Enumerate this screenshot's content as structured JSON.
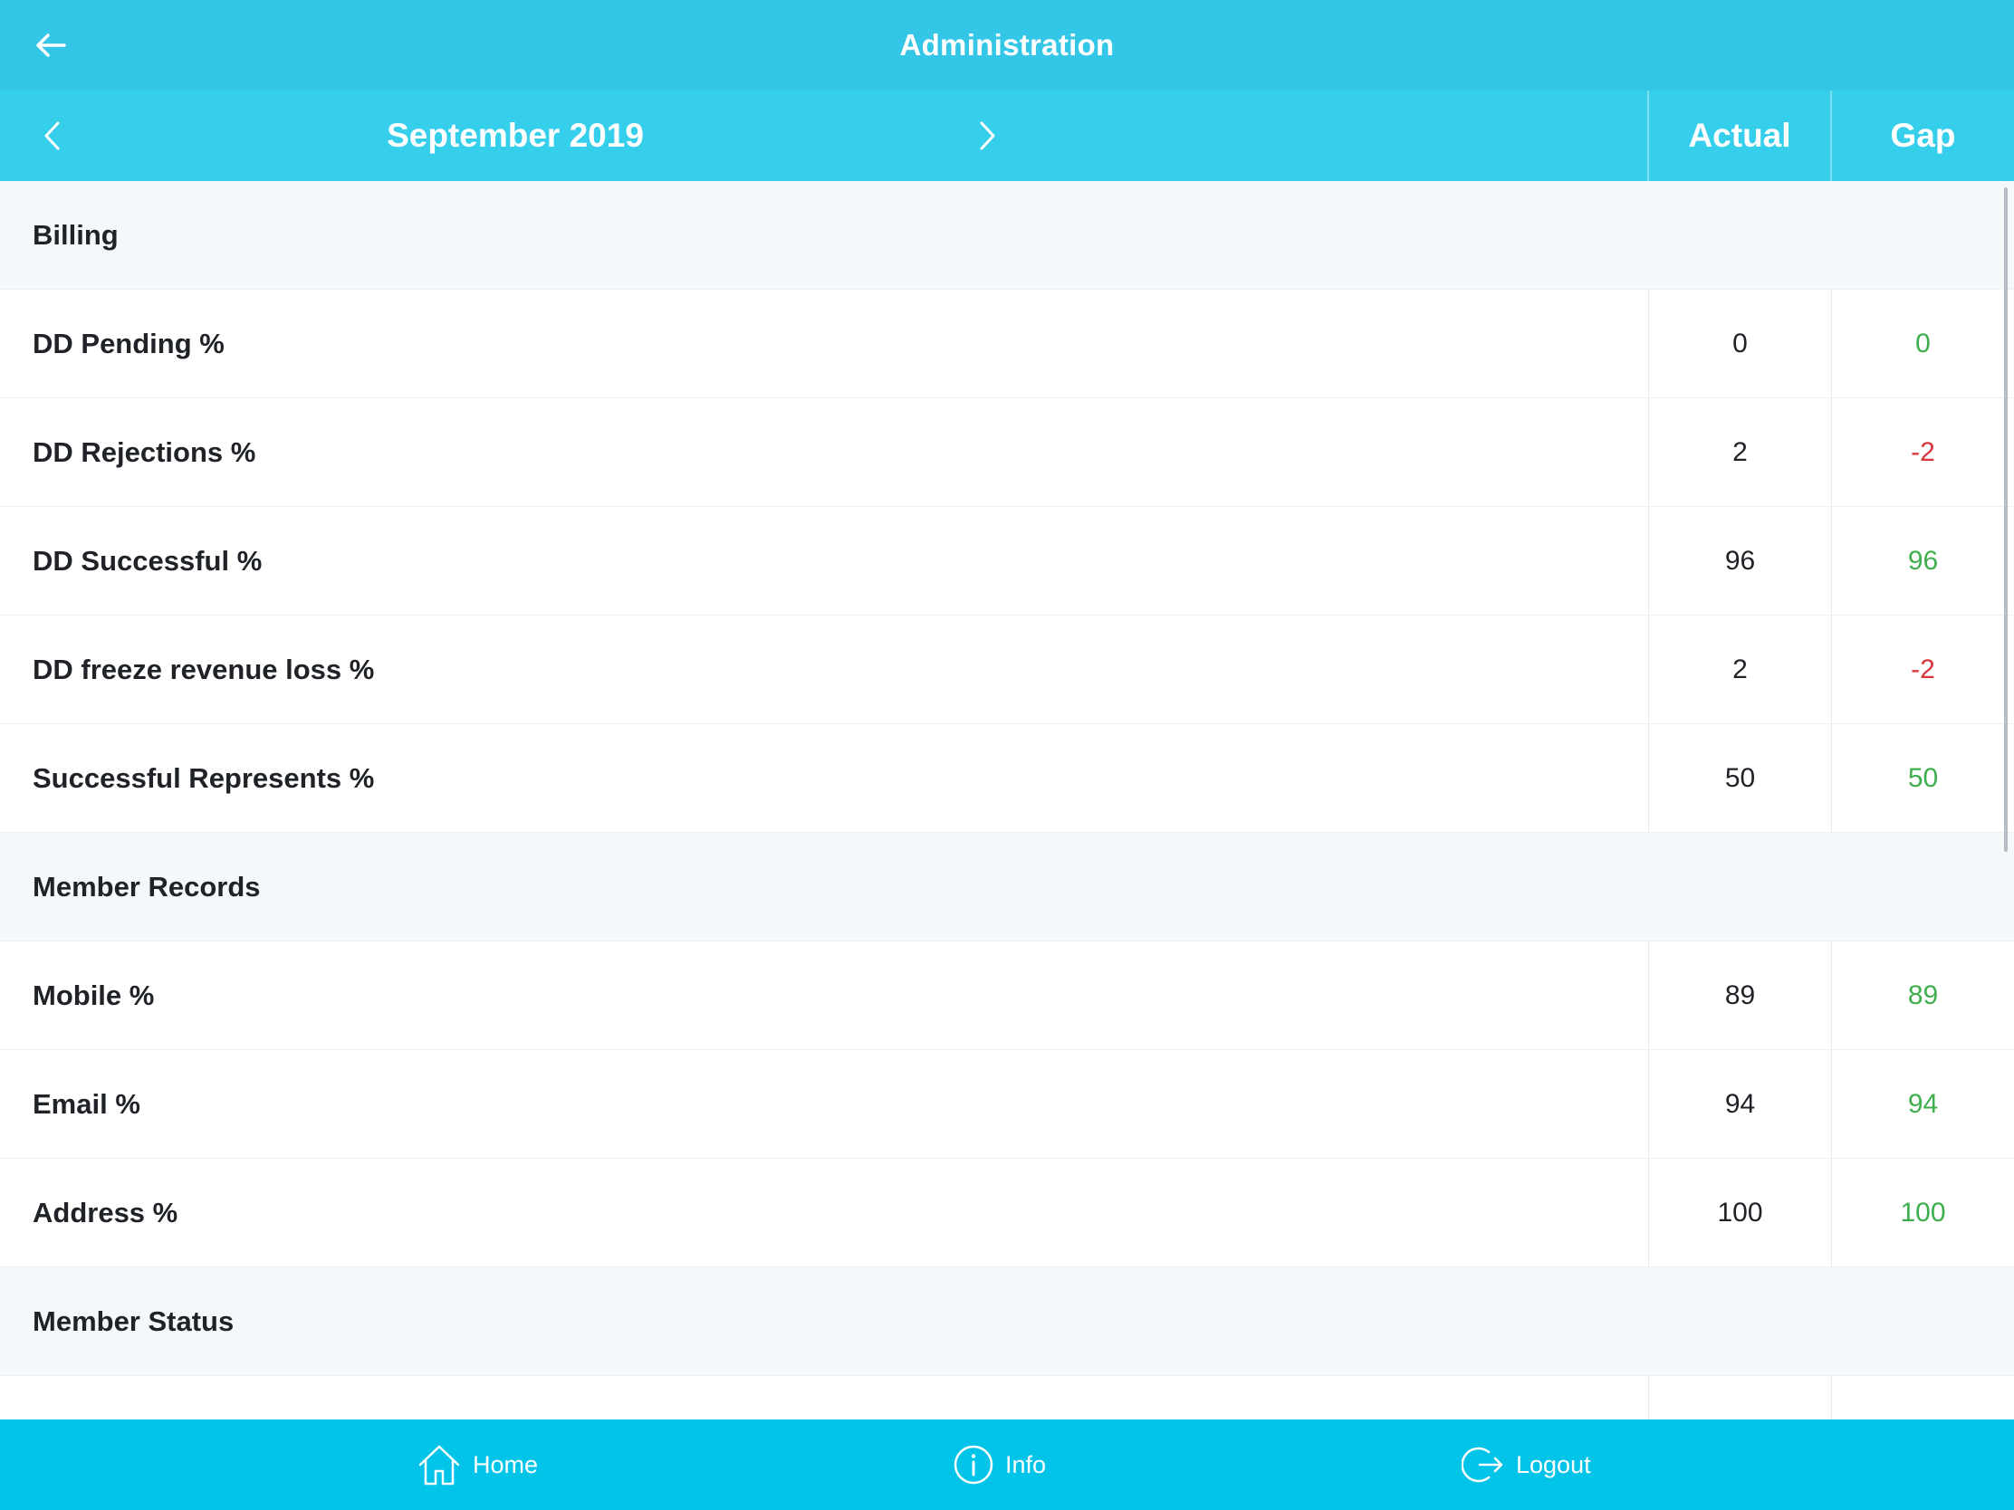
{
  "header": {
    "title": "Administration"
  },
  "period": {
    "month_label": "September 2019",
    "columns": {
      "actual": "Actual",
      "gap": "Gap"
    }
  },
  "sections": [
    {
      "title": "Billing",
      "rows": [
        {
          "label": "DD Pending %",
          "actual": "0",
          "gap": "0",
          "gap_status": "positive"
        },
        {
          "label": "DD Rejections %",
          "actual": "2",
          "gap": "-2",
          "gap_status": "negative"
        },
        {
          "label": "DD Successful %",
          "actual": "96",
          "gap": "96",
          "gap_status": "positive"
        },
        {
          "label": "DD freeze revenue loss %",
          "actual": "2",
          "gap": "-2",
          "gap_status": "negative"
        },
        {
          "label": "Successful Represents %",
          "actual": "50",
          "gap": "50",
          "gap_status": "positive"
        }
      ]
    },
    {
      "title": "Member Records",
      "rows": [
        {
          "label": "Mobile %",
          "actual": "89",
          "gap": "89",
          "gap_status": "positive"
        },
        {
          "label": "Email %",
          "actual": "94",
          "gap": "94",
          "gap_status": "positive"
        },
        {
          "label": "Address %",
          "actual": "100",
          "gap": "100",
          "gap_status": "positive"
        }
      ]
    },
    {
      "title": "Member Status",
      "rows": []
    }
  ],
  "bottom_nav": {
    "home": "Home",
    "info": "Info",
    "logout": "Logout"
  },
  "colors": {
    "header_bg": "#33c6e6",
    "subheader_bg": "#35cfec",
    "bottom_nav_bg": "#02c3e8",
    "positive": "#3fae4d",
    "negative": "#d9343a"
  },
  "icons": {
    "back": "arrow-left-icon",
    "prev": "chevron-left-icon",
    "next": "chevron-right-icon",
    "home": "home-icon",
    "info": "info-icon",
    "logout": "logout-icon"
  }
}
